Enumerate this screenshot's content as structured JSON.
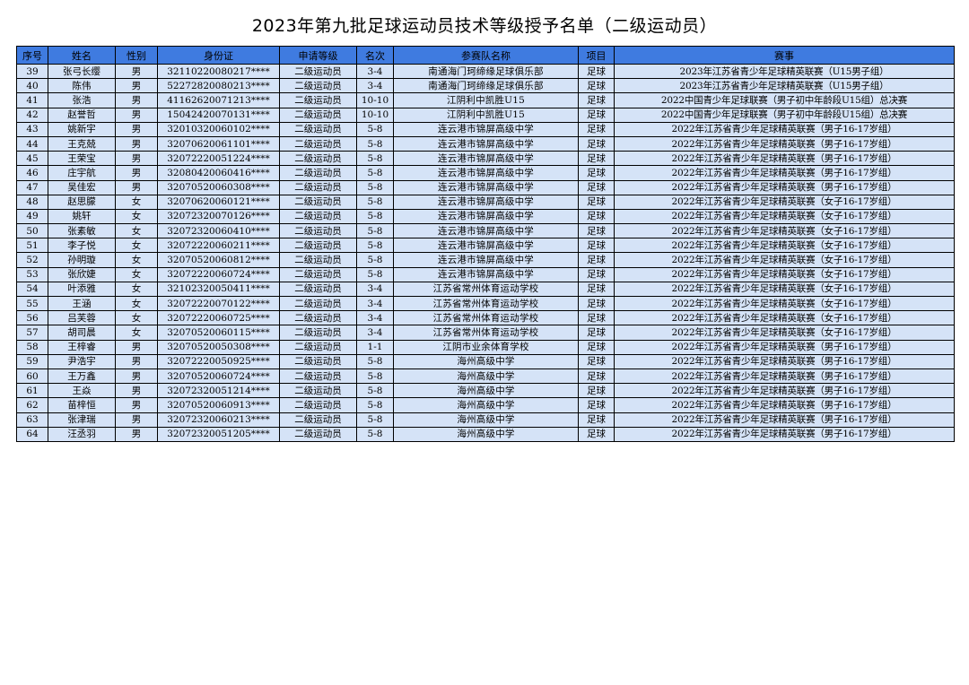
{
  "title": "2023年第九批足球运动员技术等级授予名单（二级运动员）",
  "colors": {
    "header_bg": "#3f7be0",
    "row_bg": "#d5e3f7",
    "border": "#000000"
  },
  "columns": [
    "序号",
    "姓名",
    "性别",
    "身份证",
    "申请等级",
    "名次",
    "参赛队名称",
    "项目",
    "赛事"
  ],
  "rows": [
    {
      "no": "39",
      "name": "张弓长缨",
      "gender": "男",
      "id": "32110220080217****",
      "level": "二级运动员",
      "rank": "3-4",
      "team": "南通海门珂缔缘足球俱乐部",
      "sport": "足球",
      "competition": "2023年江苏省青少年足球精英联赛（U15男子组）"
    },
    {
      "no": "40",
      "name": "陈伟",
      "gender": "男",
      "id": "52272820080213****",
      "level": "二级运动员",
      "rank": "3-4",
      "team": "南通海门珂缔缘足球俱乐部",
      "sport": "足球",
      "competition": "2023年江苏省青少年足球精英联赛（U15男子组）"
    },
    {
      "no": "41",
      "name": "张浩",
      "gender": "男",
      "id": "41162620071213****",
      "level": "二级运动员",
      "rank": "10-10",
      "team": "江阴利中凯胜U15",
      "sport": "足球",
      "competition": "2022中国青少年足球联赛（男子初中年龄段U15组）总决赛"
    },
    {
      "no": "42",
      "name": "赵誉哲",
      "gender": "男",
      "id": "15042420070131****",
      "level": "二级运动员",
      "rank": "10-10",
      "team": "江阴利中凯胜U15",
      "sport": "足球",
      "competition": "2022中国青少年足球联赛（男子初中年龄段U15组）总决赛"
    },
    {
      "no": "43",
      "name": "姚新宇",
      "gender": "男",
      "id": "32010320060102****",
      "level": "二级运动员",
      "rank": "5-8",
      "team": "连云港市锦屏高级中学",
      "sport": "足球",
      "competition": "2022年江苏省青少年足球精英联赛（男子16-17岁组）"
    },
    {
      "no": "44",
      "name": "王克兢",
      "gender": "男",
      "id": "32070620061101****",
      "level": "二级运动员",
      "rank": "5-8",
      "team": "连云港市锦屏高级中学",
      "sport": "足球",
      "competition": "2022年江苏省青少年足球精英联赛（男子16-17岁组）"
    },
    {
      "no": "45",
      "name": "王荣宝",
      "gender": "男",
      "id": "32072220051224****",
      "level": "二级运动员",
      "rank": "5-8",
      "team": "连云港市锦屏高级中学",
      "sport": "足球",
      "competition": "2022年江苏省青少年足球精英联赛（男子16-17岁组）"
    },
    {
      "no": "46",
      "name": "庄宇航",
      "gender": "男",
      "id": "32080420060416****",
      "level": "二级运动员",
      "rank": "5-8",
      "team": "连云港市锦屏高级中学",
      "sport": "足球",
      "competition": "2022年江苏省青少年足球精英联赛（男子16-17岁组）"
    },
    {
      "no": "47",
      "name": "吴佳宏",
      "gender": "男",
      "id": "32070520060308****",
      "level": "二级运动员",
      "rank": "5-8",
      "team": "连云港市锦屏高级中学",
      "sport": "足球",
      "competition": "2022年江苏省青少年足球精英联赛（男子16-17岁组）"
    },
    {
      "no": "48",
      "name": "赵思朦",
      "gender": "女",
      "id": "32070620060121****",
      "level": "二级运动员",
      "rank": "5-8",
      "team": "连云港市锦屏高级中学",
      "sport": "足球",
      "competition": "2022年江苏省青少年足球精英联赛（女子16-17岁组）"
    },
    {
      "no": "49",
      "name": "姚轩",
      "gender": "女",
      "id": "32072320070126****",
      "level": "二级运动员",
      "rank": "5-8",
      "team": "连云港市锦屏高级中学",
      "sport": "足球",
      "competition": "2022年江苏省青少年足球精英联赛（女子16-17岁组）"
    },
    {
      "no": "50",
      "name": "张素敏",
      "gender": "女",
      "id": "32072320060410****",
      "level": "二级运动员",
      "rank": "5-8",
      "team": "连云港市锦屏高级中学",
      "sport": "足球",
      "competition": "2022年江苏省青少年足球精英联赛（女子16-17岁组）"
    },
    {
      "no": "51",
      "name": "李子悦",
      "gender": "女",
      "id": "32072220060211****",
      "level": "二级运动员",
      "rank": "5-8",
      "team": "连云港市锦屏高级中学",
      "sport": "足球",
      "competition": "2022年江苏省青少年足球精英联赛（女子16-17岁组）"
    },
    {
      "no": "52",
      "name": "孙明璇",
      "gender": "女",
      "id": "32070520060812****",
      "level": "二级运动员",
      "rank": "5-8",
      "team": "连云港市锦屏高级中学",
      "sport": "足球",
      "competition": "2022年江苏省青少年足球精英联赛（女子16-17岁组）"
    },
    {
      "no": "53",
      "name": "张欣婕",
      "gender": "女",
      "id": "32072220060724****",
      "level": "二级运动员",
      "rank": "5-8",
      "team": "连云港市锦屏高级中学",
      "sport": "足球",
      "competition": "2022年江苏省青少年足球精英联赛（女子16-17岁组）"
    },
    {
      "no": "54",
      "name": "叶添雅",
      "gender": "女",
      "id": "32102320050411****",
      "level": "二级运动员",
      "rank": "3-4",
      "team": "江苏省常州体育运动学校",
      "sport": "足球",
      "competition": "2022年江苏省青少年足球精英联赛（女子16-17岁组）"
    },
    {
      "no": "55",
      "name": "王涵",
      "gender": "女",
      "id": "32072220070122****",
      "level": "二级运动员",
      "rank": "3-4",
      "team": "江苏省常州体育运动学校",
      "sport": "足球",
      "competition": "2022年江苏省青少年足球精英联赛（女子16-17岁组）"
    },
    {
      "no": "56",
      "name": "吕芙蓉",
      "gender": "女",
      "id": "32072220060725****",
      "level": "二级运动员",
      "rank": "3-4",
      "team": "江苏省常州体育运动学校",
      "sport": "足球",
      "competition": "2022年江苏省青少年足球精英联赛（女子16-17岁组）"
    },
    {
      "no": "57",
      "name": "胡司晨",
      "gender": "女",
      "id": "32070520060115****",
      "level": "二级运动员",
      "rank": "3-4",
      "team": "江苏省常州体育运动学校",
      "sport": "足球",
      "competition": "2022年江苏省青少年足球精英联赛（女子16-17岁组）"
    },
    {
      "no": "58",
      "name": "王梓睿",
      "gender": "男",
      "id": "32070520050308****",
      "level": "二级运动员",
      "rank": "1-1",
      "team": "江阴市业余体育学校",
      "sport": "足球",
      "competition": "2022年江苏省青少年足球精英联赛（男子16-17岁组）"
    },
    {
      "no": "59",
      "name": "尹浩宇",
      "gender": "男",
      "id": "32072220050925****",
      "level": "二级运动员",
      "rank": "5-8",
      "team": "海州高级中学",
      "sport": "足球",
      "competition": "2022年江苏省青少年足球精英联赛（男子16-17岁组）"
    },
    {
      "no": "60",
      "name": "王万鑫",
      "gender": "男",
      "id": "32070520060724****",
      "level": "二级运动员",
      "rank": "5-8",
      "team": "海州高级中学",
      "sport": "足球",
      "competition": "2022年江苏省青少年足球精英联赛（男子16-17岁组）"
    },
    {
      "no": "61",
      "name": "王焱",
      "gender": "男",
      "id": "32072320051214****",
      "level": "二级运动员",
      "rank": "5-8",
      "team": "海州高级中学",
      "sport": "足球",
      "competition": "2022年江苏省青少年足球精英联赛（男子16-17岁组）"
    },
    {
      "no": "62",
      "name": "苗梓恒",
      "gender": "男",
      "id": "32070520060913****",
      "level": "二级运动员",
      "rank": "5-8",
      "team": "海州高级中学",
      "sport": "足球",
      "competition": "2022年江苏省青少年足球精英联赛（男子16-17岁组）"
    },
    {
      "no": "63",
      "name": "张津瑞",
      "gender": "男",
      "id": "32072320060213****",
      "level": "二级运动员",
      "rank": "5-8",
      "team": "海州高级中学",
      "sport": "足球",
      "competition": "2022年江苏省青少年足球精英联赛（男子16-17岁组）"
    },
    {
      "no": "64",
      "name": "汪丞羽",
      "gender": "男",
      "id": "32072320051205****",
      "level": "二级运动员",
      "rank": "5-8",
      "team": "海州高级中学",
      "sport": "足球",
      "competition": "2022年江苏省青少年足球精英联赛（男子16-17岁组）"
    }
  ]
}
